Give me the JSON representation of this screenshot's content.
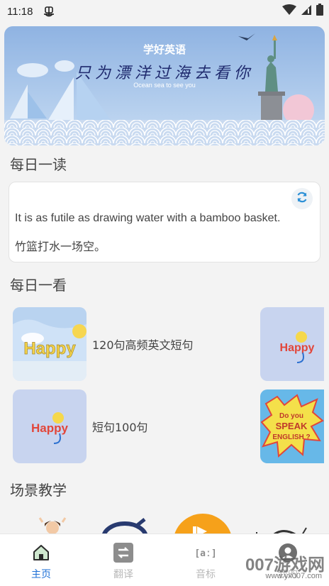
{
  "status_bar": {
    "time": "11:18"
  },
  "banner": {
    "title": "学好英语",
    "slogan": "只为漂洋过海去看你",
    "subtitle": "Ocean sea to see you"
  },
  "daily_read": {
    "section_title": "每日一读",
    "english": "It is as futile as drawing water with a bamboo basket.",
    "chinese": "竹篮打水一场空。"
  },
  "daily_look": {
    "section_title": "每日一看",
    "items": [
      {
        "label": "120句高频英文短句",
        "thumb_text": "Happy"
      },
      {
        "label": "短句100句",
        "thumb_text": "Happy"
      }
    ],
    "side_thumbs": [
      {
        "thumb_text": "Happy"
      },
      {
        "thumb_text": "Do you SPEAK ENGLISH ?"
      }
    ]
  },
  "scene_teaching": {
    "section_title": "场景教学"
  },
  "bottom_nav": {
    "items": [
      {
        "label": "主页",
        "icon": "home-icon",
        "active": true
      },
      {
        "label": "翻译",
        "icon": "translate-icon",
        "active": false
      },
      {
        "label": "音标",
        "icon": "phonetic-icon",
        "active": false
      },
      {
        "label": "我的",
        "icon": "profile-icon",
        "active": false
      }
    ]
  },
  "watermark": {
    "text": "007游戏网",
    "url": "www.yx007.com"
  },
  "colors": {
    "accent": "#1d6fd6",
    "inactive": "#b9b9b9",
    "banner_sky": "#a9c6ea"
  }
}
